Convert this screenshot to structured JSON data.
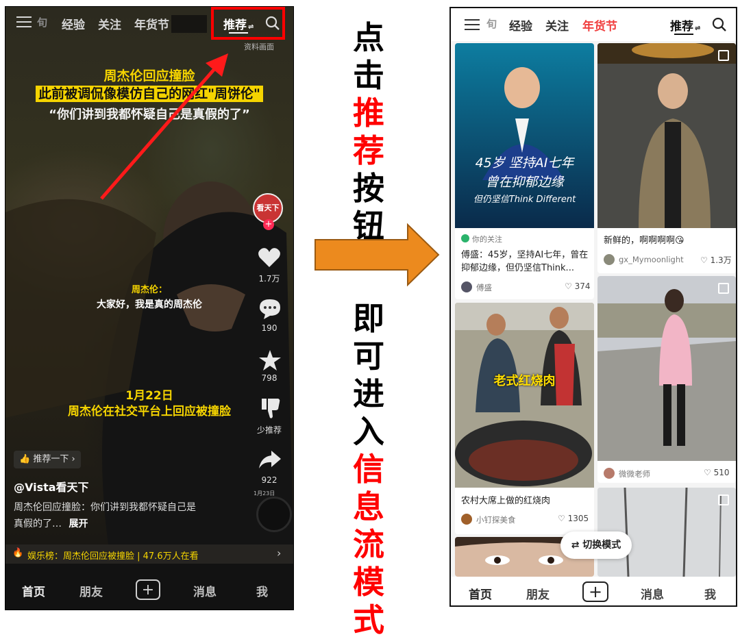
{
  "left_phone": {
    "nav": {
      "tab1": "经验",
      "tab2": "关注",
      "tab3": "年货节",
      "tab4": "推荐",
      "swap_glyph": "⇌",
      "tab_frag": "旬"
    },
    "overlay_note": "资料画面",
    "video": {
      "title_line1": "周杰伦回应撞脸",
      "title_line2": "此前被调侃像模仿自己的网红\"周饼伦\"",
      "title_line3": "“你们讲到我都怀疑自己是真假的了”",
      "sub_speaker": "周杰伦：",
      "sub_text": "大家好，我是真的周杰伦",
      "date_line": "1月22日",
      "event_line": "周杰伦在社交平台上回应被撞脸"
    },
    "side": {
      "avatar_text": "看天下",
      "likes": "1.7万",
      "comments": "190",
      "stars": "798",
      "less": "少推荐",
      "shares": "922"
    },
    "recommend_pill": "推荐一下",
    "account": "@Vista看天下",
    "caption_line1": "周杰伦回应撞脸：你们讲到我都怀疑自己是",
    "caption_line2": "真假的了…",
    "expand": "展开",
    "hot_bar": "娱乐榜：周杰伦回应被撞脸 | 47.6万人在看",
    "watermark_date": "1月23日",
    "bottom": {
      "home": "首页",
      "friends": "朋友",
      "plus": "+",
      "messages": "消息",
      "me": "我"
    },
    "colors": {
      "accent_red": "#ff0000",
      "title_yellow": "#f5d400",
      "bg": "#1b1a17"
    }
  },
  "middle": {
    "upper": [
      {
        "t": "点",
        "c": "blk"
      },
      {
        "t": "击",
        "c": "blk"
      },
      {
        "t": "推",
        "c": "red"
      },
      {
        "t": "荐",
        "c": "red"
      },
      {
        "t": "按",
        "c": "blk"
      },
      {
        "t": "钮",
        "c": "blk"
      }
    ],
    "lower": [
      {
        "t": "即",
        "c": "blk"
      },
      {
        "t": "可",
        "c": "blk"
      },
      {
        "t": "进",
        "c": "blk"
      },
      {
        "t": "入",
        "c": "blk"
      },
      {
        "t": "信",
        "c": "red"
      },
      {
        "t": "息",
        "c": "red"
      },
      {
        "t": "流",
        "c": "red"
      },
      {
        "t": "模",
        "c": "red"
      },
      {
        "t": "式",
        "c": "red"
      }
    ],
    "arrow_color": "#ec8a1e"
  },
  "right_phone": {
    "nav": {
      "tab1": "经验",
      "tab2": "关注",
      "tab3": "年货节",
      "tab4": "推荐",
      "swap_glyph": "⇌",
      "tab_frag": "旬"
    },
    "cards": [
      {
        "overlay1": "45岁 坚持AI七年",
        "overlay2": "曾在抑郁边缘",
        "overlay3": "但仍坚信Think Different",
        "follow_tag": "你的关注",
        "title": "傅盛：45岁，坚持AI七年，曾在抑郁边缘，但仍坚信Think...",
        "author": "傅盛",
        "likes": "374"
      },
      {
        "title": "新鲜的，啊啊啊啊😘",
        "author": "gx_Mymoonlight",
        "likes": "1.3万"
      },
      {
        "overlay": "老式红烧肉",
        "title": "农村大席上做的红烧肉",
        "author": "小钉探美食",
        "likes": "1305"
      },
      {
        "author": "微微老师",
        "likes": "510"
      }
    ],
    "switch_mode": "切换模式",
    "bottom": {
      "home": "首页",
      "friends": "朋友",
      "plus": "+",
      "messages": "消息",
      "me": "我"
    },
    "colors": {
      "festival_red": "#f03c3c",
      "follow_green": "#2ab36b"
    }
  }
}
